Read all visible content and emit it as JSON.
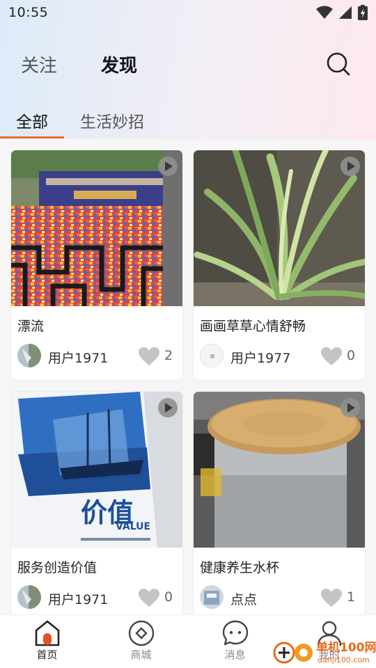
{
  "status_bar": {
    "time": "10:55"
  },
  "header": {
    "tabs": [
      {
        "label": "关注"
      },
      {
        "label": "发现"
      }
    ]
  },
  "sub_tabs": [
    {
      "label": "全部"
    },
    {
      "label": "生活妙招"
    }
  ],
  "cards": [
    {
      "title": "漂流",
      "user": "用户1971",
      "likes": "2"
    },
    {
      "title": "画画草草心情舒畅",
      "user": "用户1977",
      "likes": "0"
    },
    {
      "title": "服务创造价值",
      "user": "用户1971",
      "likes": "0"
    },
    {
      "title": "健康养生水杯",
      "user": "点点",
      "likes": "1"
    }
  ],
  "card3_image_text": {
    "main": "价值",
    "sub": "VALUE"
  },
  "bottom_nav": [
    {
      "label": "首页"
    },
    {
      "label": "商城"
    },
    {
      "label": "消息"
    },
    {
      "label": "我的"
    }
  ],
  "watermark": {
    "brand": "单机100网",
    "url": "danji100.com"
  },
  "colors": {
    "accent": "#f06a2d"
  }
}
